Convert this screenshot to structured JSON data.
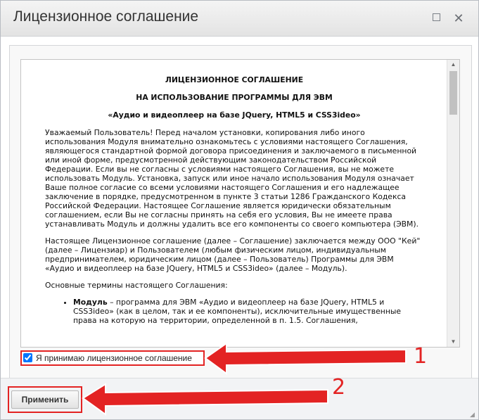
{
  "window": {
    "title": "Лицензионное соглашение",
    "maximize_icon": "maximize-icon",
    "close_icon": "close-icon",
    "close_glyph": "✕"
  },
  "license": {
    "heading1": "ЛИЦЕНЗИОННОЕ СОГЛАШЕНИЕ",
    "heading2": "НА ИСПОЛЬЗОВАНИЕ ПРОГРАММЫ ДЛЯ ЭВМ",
    "heading3": "«Аудио и видеоплеер на базе JQuery, HTML5 и CSS3ideo»",
    "para1": "Уважаемый Пользователь! Перед началом установки, копирования либо иного использования Модуля внимательно ознакомьтесь с условиями настоящего Соглашения, являющегося стандартной формой договора присоединения и заключаемого в письменной или иной форме, предусмотренной действующим законодательством Российской Федерации. Если вы не согласны с условиями настоящего Соглашения, вы не можете использовать Модуль. Установка, запуск или иное начало использования Модуля означает Ваше полное согласие со всеми условиями настоящего Соглашения и его надлежащее заключение в порядке, предусмотренном в пункте 3 статьи 1286 Гражданского Кодекса Российской Федерации. Настоящее Соглашение является юридически обязательным соглашением, если Вы не согласны принять на себя его условия, Вы не имеете права устанавливать Модуль и должны удалить все его компоненты со своего компьютера (ЭВМ).",
    "para2": "Настоящее Лицензионное соглашение (далее – Соглашение) заключается между ООО \"Кей\" (далее – Лицензиар) и Пользователем (любым физическим лицом, индивидуальным предпринимателем, юридическим лицом (далее – Пользователь) Программы для ЭВМ «Аудио и видеоплеер на базе JQuery, HTML5 и CSS3ideo» (далее – Модуль).",
    "para3": "Основные термины настоящего Соглашения:",
    "term1_bold": "Модуль",
    "term1_text": " – программа для ЭВМ «Аудио и видеоплеер на базе JQuery, HTML5 и CSS3ideo» (как в целом, так и ее компоненты), исключительные имущественные права на которую на территории, определенной в п. 1.5. Соглашения,"
  },
  "accept": {
    "label": "Я принимаю лицензионное соглашение",
    "checked": true
  },
  "footer": {
    "apply_label": "Применить"
  },
  "annotations": {
    "marker1": "1",
    "marker2": "2",
    "color": "#e32323"
  }
}
